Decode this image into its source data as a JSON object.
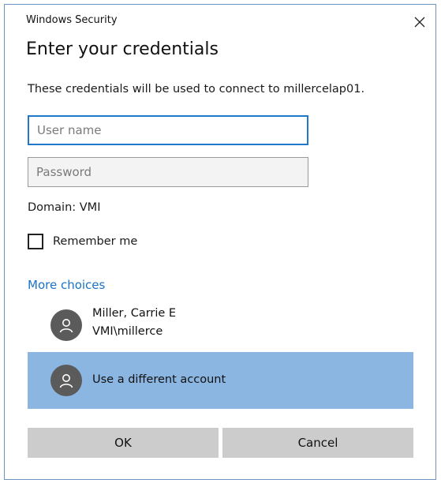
{
  "window": {
    "title": "Windows Security",
    "close_icon": "close-icon"
  },
  "dialog": {
    "heading": "Enter your credentials",
    "description": "These credentials will be used to connect to millercelap01."
  },
  "fields": {
    "username": {
      "placeholder": "User name",
      "value": ""
    },
    "password": {
      "placeholder": "Password",
      "value": ""
    }
  },
  "domain_text": "Domain: VMI",
  "remember": {
    "label": "Remember me",
    "checked": false
  },
  "more_choices": "More choices",
  "accounts": [
    {
      "name": "Miller,  Carrie E",
      "username": "VMI\\millerce",
      "icon": "user-avatar-icon"
    },
    {
      "name": "Use a different account",
      "icon": "user-avatar-icon",
      "selected": true
    }
  ],
  "buttons": {
    "ok": "OK",
    "cancel": "Cancel"
  },
  "colors": {
    "accent": "#1f78c8",
    "link": "#1a73c8",
    "selected": "#8ab6e1",
    "button": "#cccccc",
    "avatar": "#5b5b5b"
  }
}
